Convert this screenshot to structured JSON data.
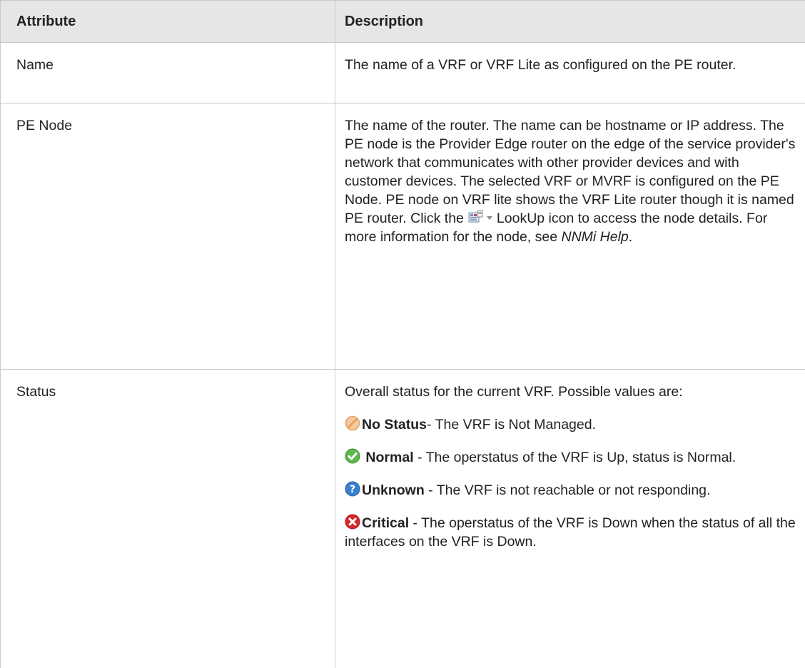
{
  "table": {
    "headers": [
      "Attribute",
      "Description"
    ],
    "rows": [
      {
        "attribute": "Name",
        "description": "The name of a VRF or VRF Lite as configured on the PE router."
      },
      {
        "attribute": "PE Node",
        "description_before_icon": "The name of the router. The name can be hostname or IP address. The PE node is the Provider Edge router on the edge of the service provider's network that communicates with other provider devices and with customer devices. The selected VRF or MVRF is configured on the PE Node. PE node on VRF lite shows the VRF Lite router though it is named PE router. Click the",
        "description_after_icon": "LookUp icon to access the node details. For more information for the node, see",
        "help_link": "NNMi Help",
        "trailing": ".",
        "lookup_icon": "lookup-node-icon"
      },
      {
        "attribute": "Status",
        "intro": "Overall status for the current VRF. Possible values are:",
        "statuses": [
          {
            "label": "No Status",
            "text": "- The VRF is Not Managed.",
            "icon": "no-status-icon",
            "color": "#f2b27a"
          },
          {
            "label": "Normal",
            "text": " - The operstatus of the VRF is Up, status is Normal.",
            "icon": "normal-icon",
            "color": "#5fb84a"
          },
          {
            "label": "Unknown",
            "text": " - The VRF is not reachable or not responding.",
            "icon": "unknown-icon",
            "color": "#3a7fd0"
          },
          {
            "label": "Critical",
            "text": " - The operstatus of the VRF is Down when the status of all the interfaces on the VRF is Down.",
            "icon": "critical-icon",
            "color": "#d9262a"
          }
        ]
      }
    ]
  }
}
